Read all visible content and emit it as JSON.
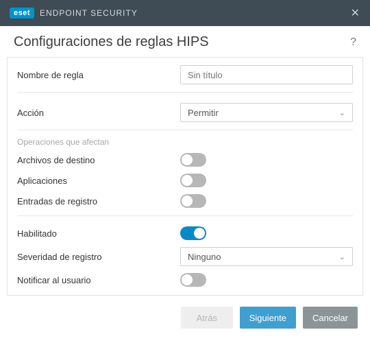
{
  "titlebar": {
    "brand_badge": "eset",
    "brand_text": "ENDPOINT SECURITY"
  },
  "header": {
    "title": "Configuraciones de reglas HIPS"
  },
  "form": {
    "rule_name_label": "Nombre de regla",
    "rule_name_placeholder": "Sin título",
    "rule_name_value": "",
    "action_label": "Acción",
    "action_selected": "Permitir",
    "section_operations_label": "Operaciones que afectan",
    "target_files_label": "Archivos de destino",
    "target_files_on": false,
    "applications_label": "Aplicaciones",
    "applications_on": false,
    "registry_entries_label": "Entradas de registro",
    "registry_entries_on": false,
    "enabled_label": "Habilitado",
    "enabled_on": true,
    "log_severity_label": "Severidad de registro",
    "log_severity_selected": "Ninguno",
    "notify_user_label": "Notificar al usuario",
    "notify_user_on": false
  },
  "footer": {
    "back_label": "Atrás",
    "next_label": "Siguiente",
    "cancel_label": "Cancelar"
  }
}
